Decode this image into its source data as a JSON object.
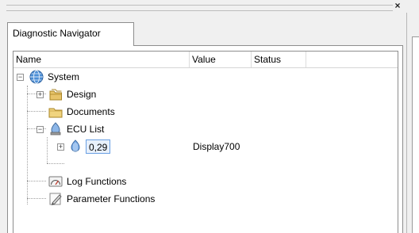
{
  "window": {
    "close_label": "×"
  },
  "tab": {
    "label": "Diagnostic Navigator"
  },
  "columns": {
    "name": "Name",
    "value": "Value",
    "status": "Status"
  },
  "tree": {
    "system": {
      "label": "System",
      "icon": "globe-icon",
      "expander": "⊟"
    },
    "design": {
      "label": "Design",
      "icon": "folder-stack-icon",
      "expander": "⊞"
    },
    "documents": {
      "label": "Documents",
      "icon": "folder-icon"
    },
    "ecu_list": {
      "label": "ECU List",
      "icon": "ecu-icon",
      "expander": "⊟"
    },
    "ecu_item": {
      "label": "0,29",
      "value": "Display700",
      "icon": "ecu-node-icon",
      "expander": "⊞"
    },
    "log_functions": {
      "label": "Log Functions",
      "icon": "gauge-icon"
    },
    "parameter_functions": {
      "label": "Parameter Functions",
      "icon": "pencil-icon"
    }
  }
}
